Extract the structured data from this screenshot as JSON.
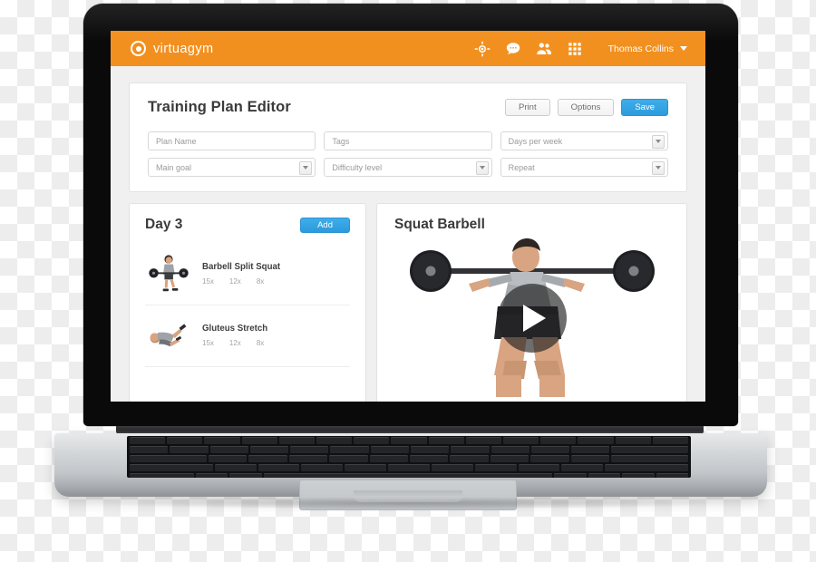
{
  "topbar": {
    "brand_name": "virtuagym",
    "brand_icon": "bullseye-icon",
    "icons": [
      {
        "name": "crosshair-icon"
      },
      {
        "name": "chat-bubble-icon"
      },
      {
        "name": "people-icon"
      },
      {
        "name": "grid-apps-icon"
      }
    ],
    "user_name": "Thomas Collins",
    "caret_icon": "chevron-down-icon",
    "background_color": "#f2901f"
  },
  "editor": {
    "title": "Training Plan Editor",
    "buttons": {
      "print": "Print",
      "options": "Options",
      "save": "Save"
    },
    "primary_color": "#2b9bdc",
    "fields": [
      {
        "placeholder": "Plan Name",
        "type": "text"
      },
      {
        "placeholder": "Tags",
        "type": "text"
      },
      {
        "placeholder": "Days per week",
        "type": "select"
      },
      {
        "placeholder": "Main goal",
        "type": "select"
      },
      {
        "placeholder": "Difficulty level",
        "type": "select"
      },
      {
        "placeholder": "Repeat",
        "type": "select"
      }
    ]
  },
  "day_panel": {
    "title": "Day 3",
    "add_label": "Add",
    "exercises": [
      {
        "name": "Barbell Split Squat",
        "reps": [
          "15x",
          "12x",
          "8x"
        ]
      },
      {
        "name": "Gluteus Stretch",
        "reps": [
          "15x",
          "12x",
          "8x"
        ]
      }
    ]
  },
  "detail_panel": {
    "title": "Squat Barbell",
    "play_icon": "play-button-icon"
  }
}
